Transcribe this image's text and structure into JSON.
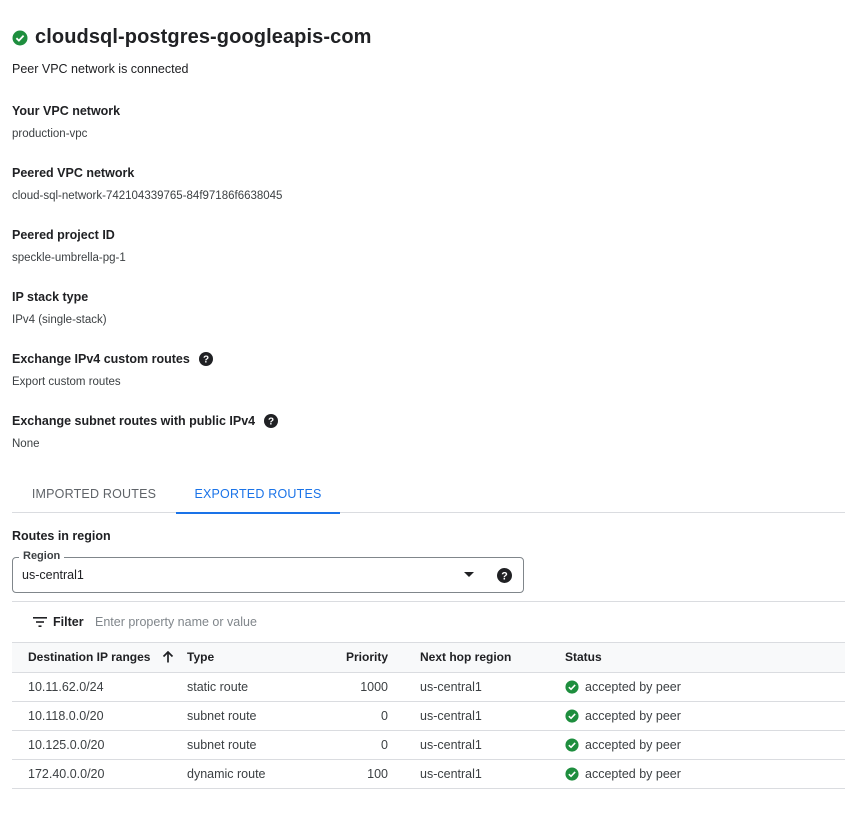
{
  "header": {
    "title": "cloudsql-postgres-googleapis-com",
    "subtitle": "Peer VPC network is connected",
    "status_icon": "check-circle-icon",
    "status_color": "#1e8e3e"
  },
  "properties": [
    {
      "label": "Your VPC network",
      "value": "production-vpc"
    },
    {
      "label": "Peered VPC network",
      "value": "cloud-sql-network-742104339765-84f97186f6638045"
    },
    {
      "label": "Peered project ID",
      "value": "speckle-umbrella-pg-1"
    },
    {
      "label": "IP stack type",
      "value": "IPv4 (single-stack)"
    },
    {
      "label": "Exchange IPv4 custom routes",
      "value": "Export custom routes",
      "help_icon": "help-circle-icon"
    },
    {
      "label": "Exchange subnet routes with public IPv4",
      "value": "None",
      "help_icon": "help-circle-icon"
    }
  ],
  "tabs": [
    {
      "label": "IMPORTED ROUTES",
      "active": false
    },
    {
      "label": "EXPORTED ROUTES",
      "active": true
    }
  ],
  "accent_color": "#1a73e8",
  "routes_section": {
    "title": "Routes in region",
    "region_label": "Region",
    "region_value": "us-central1"
  },
  "filter": {
    "label": "Filter",
    "placeholder": "Enter property name or value"
  },
  "table": {
    "columns": [
      "Destination IP ranges",
      "Type",
      "Priority",
      "Next hop region",
      "Status"
    ],
    "sort_icon": "arrow-up-icon",
    "rows": [
      {
        "destination": "10.11.62.0/24",
        "type": "static route",
        "priority": "1000",
        "next_hop_region": "us-central1",
        "status": "accepted by peer"
      },
      {
        "destination": "10.118.0.0/20",
        "type": "subnet route",
        "priority": "0",
        "next_hop_region": "us-central1",
        "status": "accepted by peer"
      },
      {
        "destination": "10.125.0.0/20",
        "type": "subnet route",
        "priority": "0",
        "next_hop_region": "us-central1",
        "status": "accepted by peer"
      },
      {
        "destination": "172.40.0.0/20",
        "type": "dynamic route",
        "priority": "100",
        "next_hop_region": "us-central1",
        "status": "accepted by peer"
      }
    ]
  }
}
